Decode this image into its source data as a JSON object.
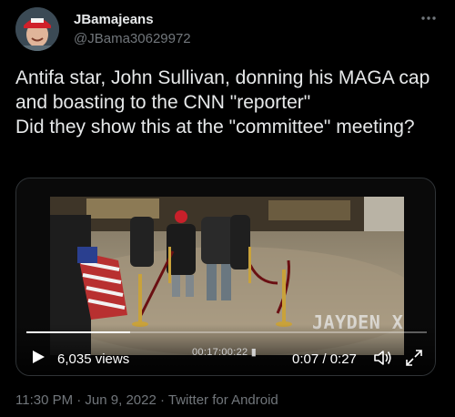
{
  "user": {
    "display_name": "JBamajeans",
    "handle": "@JBama30629972",
    "avatar_icon": "user-avatar-photo"
  },
  "tweet": {
    "text": "Antifa star, John Sullivan, donning his MAGA cap and boasting to the CNN \"reporter\"\nDid they show this at the \"committee\" meeting?"
  },
  "video": {
    "views": "6,035 views",
    "timecode": "00:17:00:22",
    "time": "0:07 / 0:27",
    "watermark": "JAYDEN X",
    "progress_fraction": 0.26
  },
  "meta": {
    "timestamp_line": "11:30 PM · Jun 9, 2022 · Twitter for Android"
  },
  "colors": {
    "background": "#000000",
    "text": "#e7e9ea",
    "secondary": "#71767b",
    "border": "#2f3336"
  }
}
